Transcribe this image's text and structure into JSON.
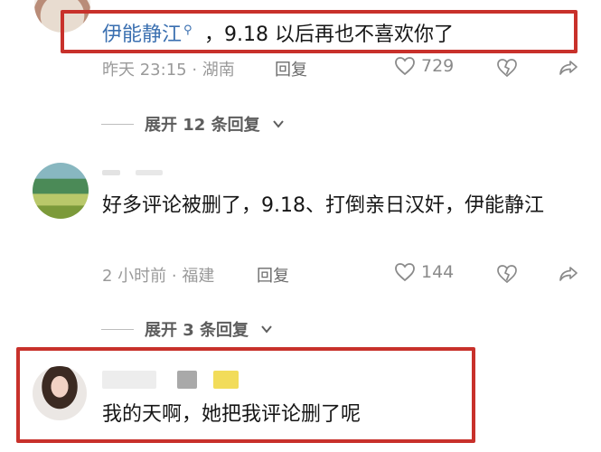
{
  "comments": [
    {
      "author": "伊能静江",
      "search_marker": "⚲",
      "text": "，9.18 以后再也不喜欢你了",
      "meta": "昨天 23:15 · 湖南",
      "reply_label": "回复",
      "likes": "729"
    },
    {
      "text": "好多评论被删了，9.18、打倒亲日汉奸，伊能静江",
      "meta": "2 小时前 · 福建",
      "reply_label": "回复",
      "likes": "144"
    },
    {
      "text": "我的天啊，她把我评论删了呢"
    }
  ],
  "expand_replies": [
    {
      "label": "展开 12 条回复"
    },
    {
      "label": "展开 3 条回复"
    }
  ],
  "colors": {
    "highlight_border": "#c8312b",
    "username": "#3a6fb0",
    "meta_text": "#9a9a9a"
  }
}
